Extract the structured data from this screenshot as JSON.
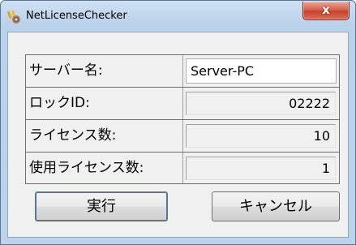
{
  "window": {
    "title": "NetLicenseChecker",
    "close_glyph": "x",
    "icon": "app-icon"
  },
  "fields": [
    {
      "label": "サーバー名:",
      "value": "Server-PC",
      "editable": true
    },
    {
      "label": "ロックID:",
      "value": "02222",
      "editable": false
    },
    {
      "label": "ライセンス数:",
      "value": "10",
      "editable": false
    },
    {
      "label": "使用ライセンス数:",
      "value": "1",
      "editable": false
    }
  ],
  "buttons": {
    "run_label": "実行",
    "cancel_label": "キャンセル"
  },
  "colors": {
    "titlebar": "#bcd3ec",
    "client": "#f0f0f0",
    "close_button": "#c7422c"
  }
}
